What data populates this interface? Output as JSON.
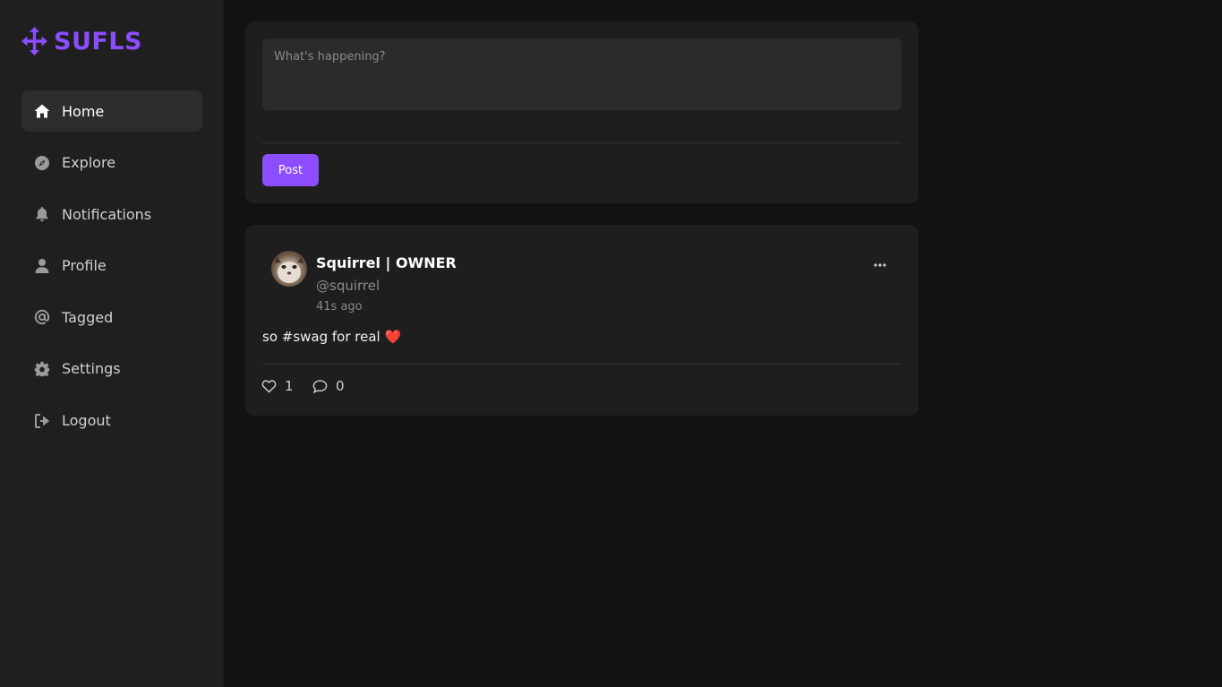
{
  "brand": {
    "name": "SUFLS",
    "icon": "arrows-move-icon",
    "color": "#8b4dff"
  },
  "nav": {
    "items": [
      {
        "label": "Home",
        "icon": "home-icon",
        "active": true
      },
      {
        "label": "Explore",
        "icon": "compass-icon",
        "active": false
      },
      {
        "label": "Notifications",
        "icon": "bell-icon",
        "active": false
      },
      {
        "label": "Profile",
        "icon": "user-icon",
        "active": false
      },
      {
        "label": "Tagged",
        "icon": "at-icon",
        "active": false
      },
      {
        "label": "Settings",
        "icon": "gear-icon",
        "active": false
      },
      {
        "label": "Logout",
        "icon": "logout-icon",
        "active": false
      }
    ]
  },
  "composer": {
    "placeholder": "What's happening?",
    "value": "",
    "post_label": "Post"
  },
  "post": {
    "author": "Squirrel | OWNER",
    "handle": "@squirrel",
    "time": "41s ago",
    "text": "so #swag for real",
    "emoji": "❤️",
    "likes": "1",
    "comments": "0"
  },
  "colors": {
    "background": "#121212",
    "sidebar": "#1f1f1f",
    "card": "#1e1e1e",
    "accent": "#8b4dff"
  }
}
